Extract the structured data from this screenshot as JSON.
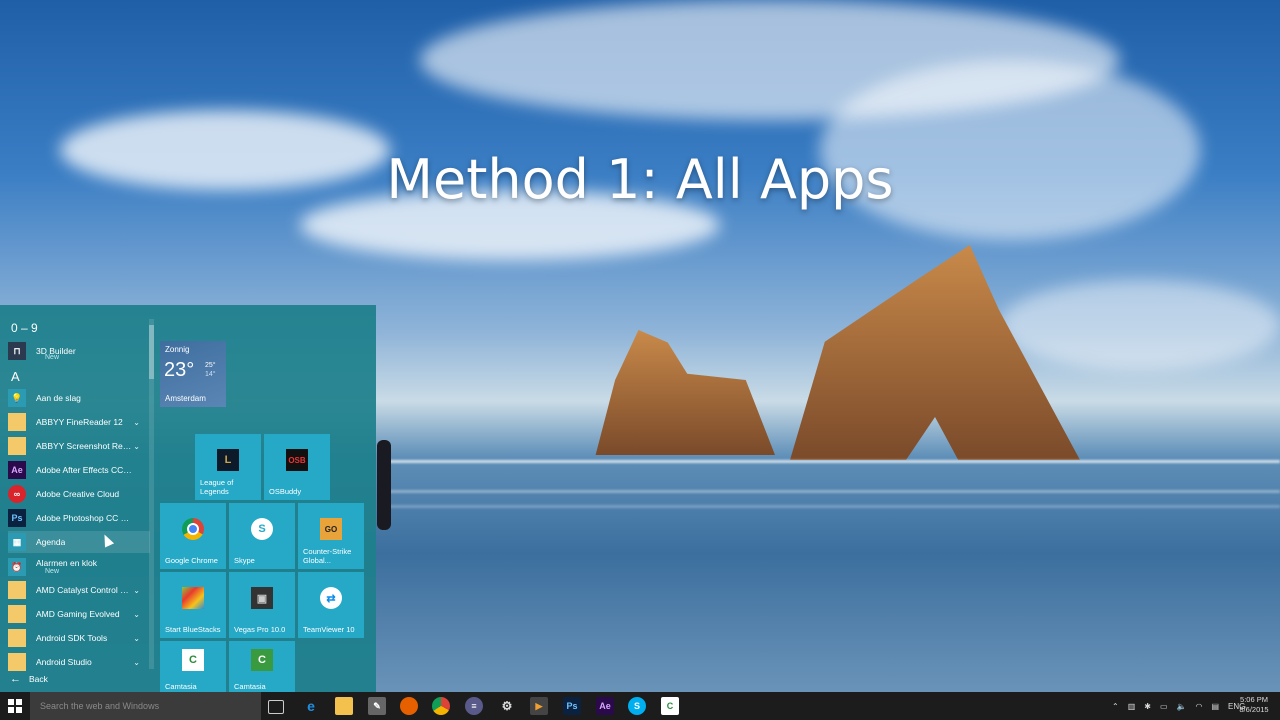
{
  "overlay": {
    "title": "Method 1: All Apps"
  },
  "start_menu": {
    "groups": [
      "0 – 9",
      "A"
    ],
    "apps": [
      {
        "label": "3D Builder",
        "sub": "New",
        "icon": "3d-builder-icon",
        "chev": ""
      },
      {
        "label": "Aan de slag",
        "sub": "",
        "icon": "lightbulb-icon",
        "chev": ""
      },
      {
        "label": "ABBYY FineReader 12",
        "sub": "",
        "icon": "folder-icon",
        "chev": "⌄"
      },
      {
        "label": "ABBYY Screenshot Reader",
        "sub": "",
        "icon": "folder-icon",
        "chev": "⌄"
      },
      {
        "label": "Adobe After Effects CC 2014",
        "sub": "",
        "icon": "after-effects-icon",
        "chev": ""
      },
      {
        "label": "Adobe Creative Cloud",
        "sub": "",
        "icon": "creative-cloud-icon",
        "chev": ""
      },
      {
        "label": "Adobe Photoshop CC 2014",
        "sub": "",
        "icon": "photoshop-icon",
        "chev": ""
      },
      {
        "label": "Agenda",
        "sub": "",
        "icon": "calendar-icon",
        "chev": ""
      },
      {
        "label": "Alarmen en klok",
        "sub": "New",
        "icon": "alarm-clock-icon",
        "chev": ""
      },
      {
        "label": "AMD Catalyst Control C...",
        "sub": "",
        "icon": "folder-icon",
        "chev": "⌄"
      },
      {
        "label": "AMD Gaming Evolved",
        "sub": "",
        "icon": "folder-icon",
        "chev": "⌄"
      },
      {
        "label": "Android SDK Tools",
        "sub": "",
        "icon": "folder-icon",
        "chev": "⌄"
      },
      {
        "label": "Android Studio",
        "sub": "",
        "icon": "folder-icon",
        "chev": "⌄"
      }
    ],
    "back_label": "Back",
    "weather": {
      "condition": "Zonnig",
      "temp": "23°",
      "high": "25°",
      "low": "14°",
      "city": "Amsterdam"
    },
    "tiles": {
      "lol": "League of Legends",
      "osbuddy": "OSBuddy",
      "chrome": "Google Chrome",
      "skype": "Skype",
      "csgo": "Counter-Strike Global...",
      "bluestacks": "Start BlueStacks",
      "vegas": "Vegas Pro 10.0",
      "teamviewer": "TeamViewer 10",
      "camtasia1": "Camtasia",
      "camtasia2": "Camtasia"
    }
  },
  "taskbar": {
    "search_placeholder": "Search the web and Windows",
    "time": "5:06 PM",
    "date": "8/6/2015",
    "lang": "ENG"
  }
}
